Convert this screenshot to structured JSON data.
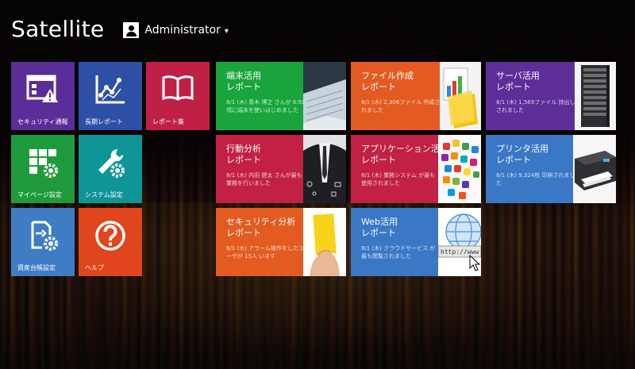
{
  "app": {
    "title": "Satellite"
  },
  "user": {
    "name": "Administrator",
    "caret": "▾"
  },
  "small_tiles": [
    {
      "label": "セキュリティ通報",
      "icon": "security-alert-icon",
      "color": "#5a2d98"
    },
    {
      "label": "長期レポート",
      "icon": "line-chart-icon",
      "color": "#2e4fa6"
    },
    {
      "label": "レポート集",
      "icon": "open-book-icon",
      "color": "#bf2046"
    },
    {
      "label": "マイページ設定",
      "icon": "grid-settings-icon",
      "color": "#1f9a3c"
    },
    {
      "label": "システム設定",
      "icon": "tools-settings-icon",
      "color": "#0e9595"
    },
    {
      "label": "資産台帳設定",
      "icon": "asset-settings-icon",
      "color": "#3f7cc4"
    },
    {
      "label": "ヘルプ",
      "icon": "help-icon",
      "color": "#e0461e"
    }
  ],
  "report_tiles": [
    {
      "title1": "端末活用",
      "title2": "レポート",
      "desc": "8/1 (木) 青木 博之 さんが 6:50 頃に端末を使いはじめました",
      "image": "laptop-keyboard-image",
      "color": "#19a53c"
    },
    {
      "title1": "ファイル作成",
      "title2": "レポート",
      "desc": "8/1 (木) 2,306ファイル 作成されました",
      "image": "documents-chart-image",
      "color": "#e35b20"
    },
    {
      "title1": "サーバ活用",
      "title2": "レポート",
      "desc": "8/1 (木) 1,569ファイル 持出しされました",
      "image": "server-rack-image",
      "color": "#5d2d98"
    },
    {
      "title1": "行動分析",
      "title2": "レポート",
      "desc": "8/1 (木) 内田 健太 さんが最も業務を行いました",
      "image": "businessman-image",
      "color": "#c22045"
    },
    {
      "title1": "アプリケーション活用",
      "title2": "レポート",
      "desc": "8/1 (木) 業務システム が最も使用されました",
      "image": "app-icons-image",
      "color": "#c22045"
    },
    {
      "title1": "プリンタ活用",
      "title2": "レポート",
      "desc": "8/1 (木) 9,324枚 印刷されました",
      "image": "printer-image",
      "color": "#3a78c6"
    },
    {
      "title1": "セキュリティ分析",
      "title2": "レポート",
      "desc": "8/1 (木) アラーム操作をしたユーザが 15人 います",
      "image": "yellow-card-image",
      "color": "#e35b20"
    },
    {
      "title1": "Web活用",
      "title2": "レポート",
      "desc": "8/1 (木) クラウドサービス が最も閲覧されました",
      "image": "web-globe-image",
      "color": "#3a78c6"
    }
  ]
}
